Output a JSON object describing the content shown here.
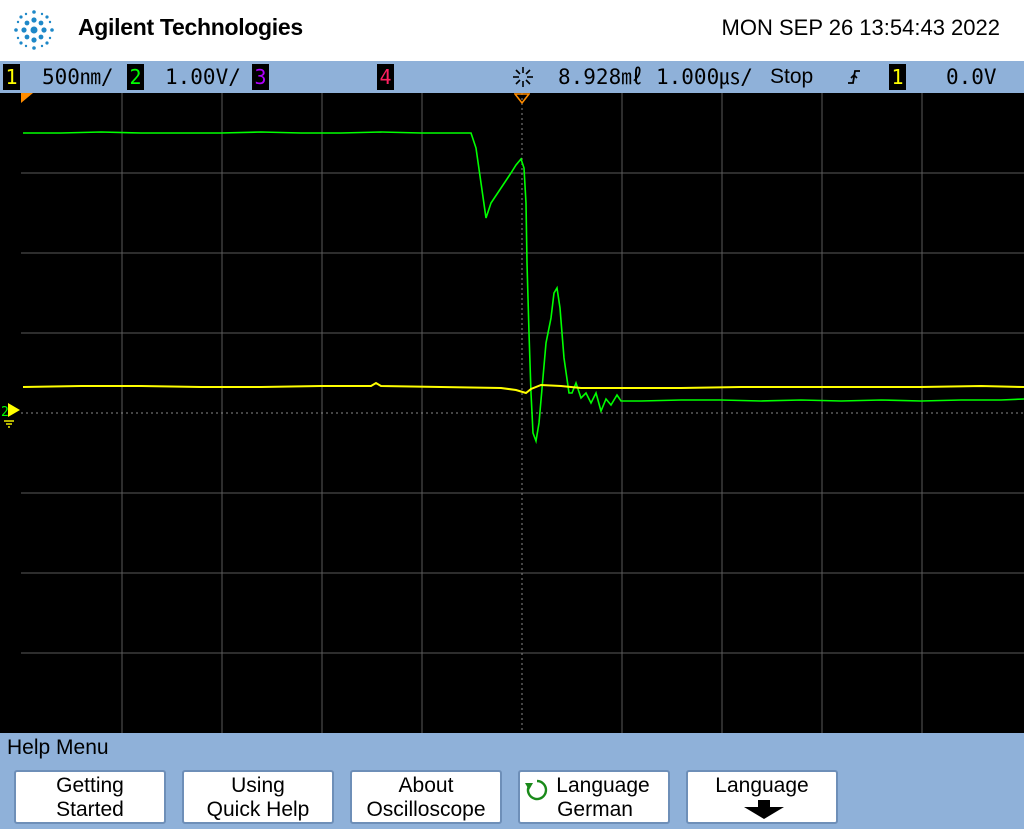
{
  "header": {
    "brand": "Agilent Technologies",
    "datetime": "MON SEP 26 13:54:43 2022"
  },
  "status_bar": {
    "ch1": {
      "number": "1",
      "scale": "500㎚/",
      "color": "#ffff00"
    },
    "ch2": {
      "number": "2",
      "scale": "1.00V/",
      "color": "#00ff00"
    },
    "ch3": {
      "number": "3",
      "color": "#b000ff"
    },
    "ch4": {
      "number": "4",
      "color": "#ff2060"
    },
    "time_delay": "8.928㎖",
    "time_base": "1.000㎲/",
    "run_state": "Stop",
    "trigger_source": "1",
    "trigger_level": "0.0V"
  },
  "help_menu": {
    "title": "Help Menu",
    "softkeys": [
      {
        "line1": "Getting",
        "line2": "Started"
      },
      {
        "line1": "Using",
        "line2": "Quick Help"
      },
      {
        "line1": "About",
        "line2": "Oscilloscope"
      },
      {
        "line1": "Language",
        "line2": "German"
      },
      {
        "line1": "Language",
        "line2": ""
      }
    ]
  },
  "colors": {
    "accent_blue": "#8fb1d9",
    "ch1_trace": "#ffff00",
    "ch2_trace": "#00ff00"
  }
}
